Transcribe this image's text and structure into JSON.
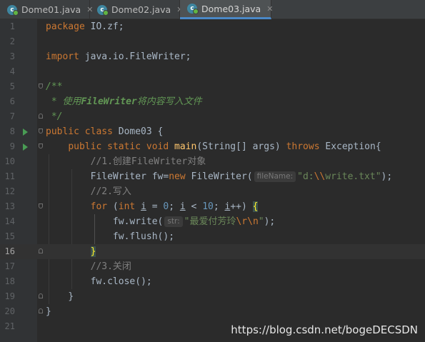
{
  "tabs": [
    {
      "label": "Dome01.java",
      "icon": "java-class-icon",
      "close": "✕",
      "active": false
    },
    {
      "label": "Dome02.java",
      "icon": "java-class-icon",
      "close": "✕",
      "active": false
    },
    {
      "label": "Dome03.java",
      "icon": "java-class-icon",
      "close": "✕",
      "active": true
    }
  ],
  "editor": {
    "current_line": 16,
    "line_numbers": [
      "1",
      "2",
      "3",
      "4",
      "5",
      "6",
      "7",
      "8",
      "9",
      "10",
      "11",
      "12",
      "13",
      "14",
      "15",
      "16",
      "17",
      "18",
      "19",
      "20",
      "21"
    ],
    "code": {
      "l1_kw": "package",
      "l1_rest": " IO.zf;",
      "l3_kw": "import",
      "l3_rest": " java.io.FileWriter;",
      "l5": "/**",
      "l6_a": " * 使用",
      "l6_b": "FileWriter",
      "l6_c": "将内容写入文件",
      "l7": " */",
      "l8_kw": "public class",
      "l8_rest": " Dome03 {",
      "l9_kw1": "public static void",
      "l9_fn": "main",
      "l9_mid": "(String[] args) ",
      "l9_kw2": "throws",
      "l9_rest": " Exception{",
      "l10": "//1.创建FileWriter对象",
      "l11_a": "FileWriter fw=",
      "l11_kw": "new",
      "l11_b": " FileWriter(",
      "l11_hint": "fileName:",
      "l11_str1": "\"d:",
      "l11_esc": "\\\\",
      "l11_str2": "write.txt\"",
      "l11_end": ");",
      "l12": "//2.写入",
      "l13_kw1": "for",
      "l13_a": " (",
      "l13_kw2": "int",
      "l13_b": " ",
      "l13_i1": "i",
      "l13_c": " = ",
      "l13_n1": "0",
      "l13_d": "; ",
      "l13_i2": "i",
      "l13_e": " < ",
      "l13_n2": "10",
      "l13_f": "; ",
      "l13_i3": "i",
      "l13_g": "++) ",
      "l13_brace": "{",
      "l14_a": "fw.write(",
      "l14_hint": "str:",
      "l14_str1": "\"最爱付芳玲",
      "l14_esc": "\\r\\n",
      "l14_str2": "\"",
      "l14_end": ");",
      "l15": "fw.flush();",
      "l16_brace": "}",
      "l17": "//3.关闭",
      "l18": "fw.close();",
      "l19": "}",
      "l20": "}"
    }
  },
  "watermark": "https://blog.csdn.net/bogeDECSDN",
  "colors": {
    "background": "#2b2b2b",
    "keyword": "#cc7832",
    "string": "#6a8759",
    "comment": "#808080",
    "doc_comment": "#629755",
    "method": "#ffc66d",
    "number": "#6897bb",
    "run_icon": "#499c54",
    "active_tab_underline": "#4a88c7"
  }
}
